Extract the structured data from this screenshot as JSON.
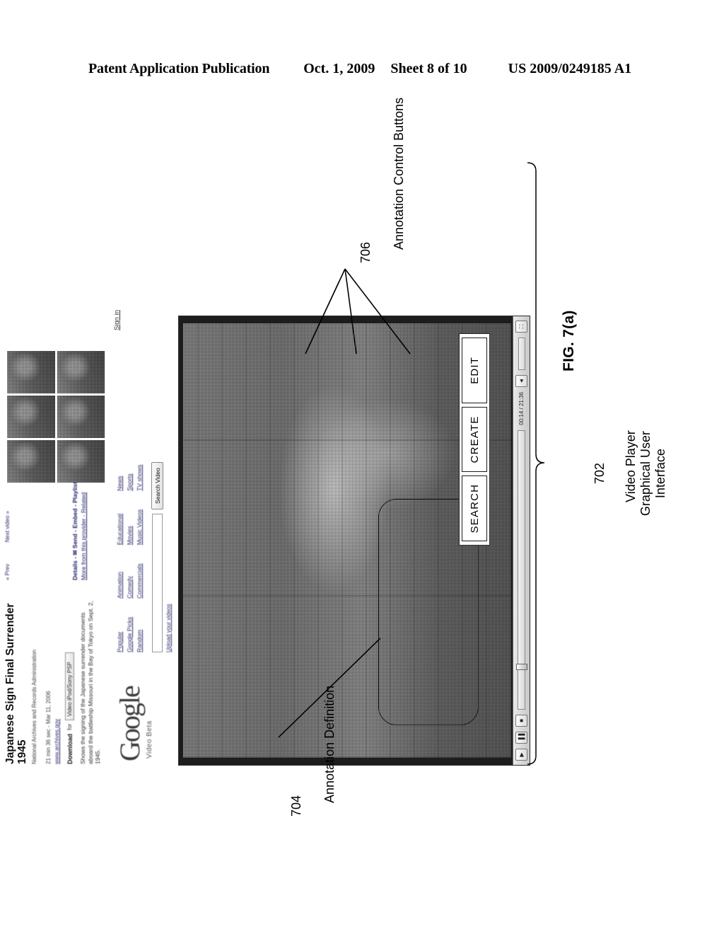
{
  "patent_header": {
    "publication": "Patent Application Publication",
    "date": "Oct. 1, 2009",
    "sheet": "Sheet 8 of 10",
    "number": "US 2009/0249185 A1"
  },
  "figure": {
    "caption": "FIG. 7(a)"
  },
  "callouts": [
    {
      "ref": "704",
      "text": "Annotation Definition"
    },
    {
      "ref": "706",
      "text": "Annotation Control Buttons"
    },
    {
      "ref": "702",
      "text": "Video Player\nGraphical User\nInterface"
    }
  ],
  "screenshot": {
    "masthead": {
      "logo": "Google",
      "logo_sub": "Video Beta",
      "signin_link": "Sign in"
    },
    "category_nav": [
      {
        "links": [
          "Popular",
          "Google Picks",
          "Random"
        ]
      },
      {
        "links": [
          "Animation",
          "Comedy",
          "Commercials"
        ]
      },
      {
        "links": [
          "Educational",
          "Movies",
          "Music Videos"
        ]
      },
      {
        "links": [
          "News",
          "Sports",
          "TV shows"
        ]
      }
    ],
    "search": {
      "value": "",
      "placeholder": "",
      "button_label": "Search Video",
      "upload_link": "Upload your videos"
    },
    "video": {
      "title": "Japanese Sign Final Surrender 1945",
      "source": "National Archives and Records Administration",
      "duration": "21 min 36 sec  -  Mar 11, 2006",
      "fullscreen_link": "www.archives.gov",
      "download_label": "Download",
      "download_for": "for",
      "download_option": "Video iPod/Sony PSP",
      "description": "Shows the signing of the Japanese surrender documents aboard the battleship Missouri in the Bay of Tokyo on Sept. 2, 1945.",
      "prev_link": "« Prev",
      "next_link": "Next video »",
      "links_primary": "Details  -  ✉ Send  -  Embed  -  Playlist",
      "links_secondary": "More from this provider  -  Related"
    },
    "player_controls": {
      "play_icon": "▶",
      "pause_icon": "▐▐",
      "stop_icon": "■",
      "time": "00:14 / 21:36",
      "volume_icon": "◄",
      "fullscreen_icon": "⛶"
    },
    "annotation_controls": {
      "buttons": [
        "SEARCH",
        "CREATE",
        "EDIT"
      ]
    },
    "thumbnails": [
      {
        "id": "thumb-1"
      },
      {
        "id": "thumb-2"
      },
      {
        "id": "thumb-3"
      },
      {
        "id": "thumb-4"
      },
      {
        "id": "thumb-5"
      },
      {
        "id": "thumb-6"
      }
    ]
  }
}
